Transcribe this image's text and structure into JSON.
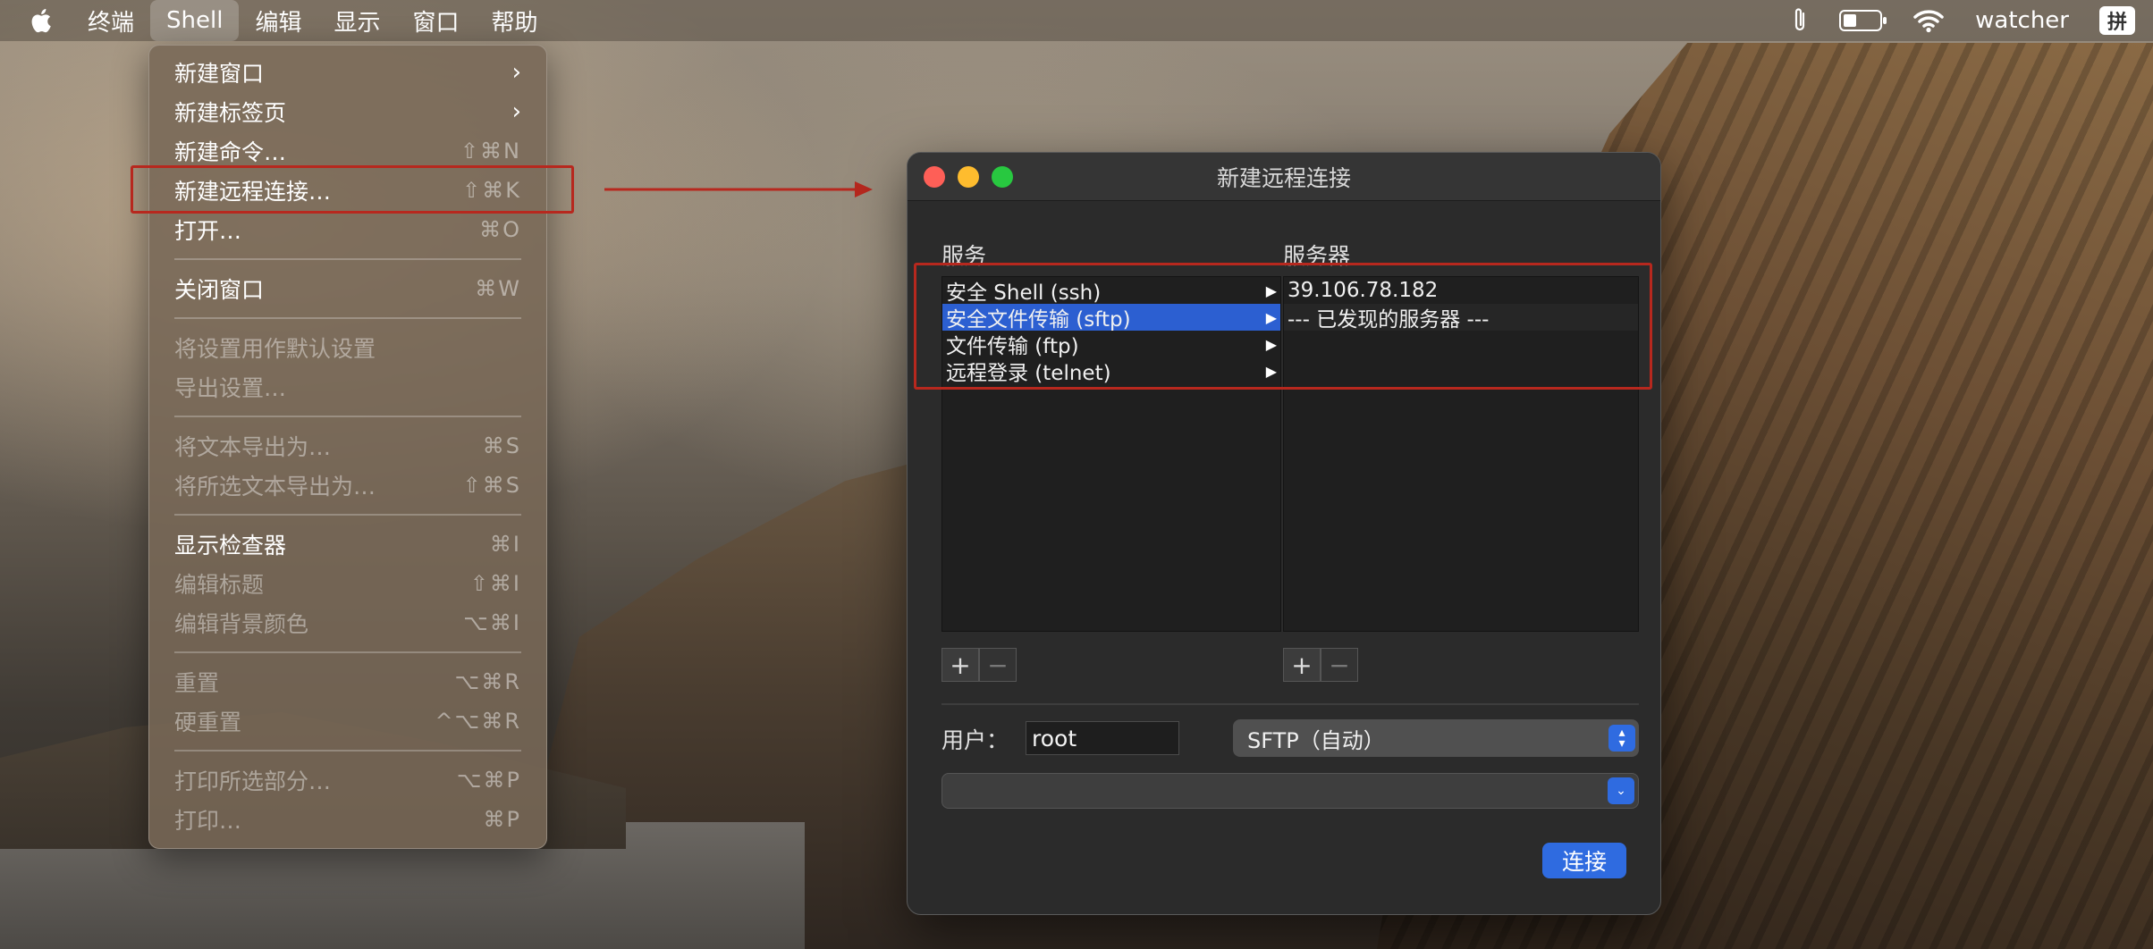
{
  "menubar": {
    "items": [
      "终端",
      "Shell",
      "编辑",
      "显示",
      "窗口",
      "帮助"
    ],
    "active_index": 1,
    "right": {
      "user": "watcher",
      "ime": "拼",
      "battery_level": 0.35
    }
  },
  "shell_menu": {
    "items": [
      {
        "label": "新建窗口",
        "shortcut": "",
        "submenu": true,
        "disabled": false
      },
      {
        "label": "新建标签页",
        "shortcut": "",
        "submenu": true,
        "disabled": false
      },
      {
        "label": "新建命令…",
        "shortcut": "⇧⌘N",
        "submenu": false,
        "disabled": false
      },
      {
        "label": "新建远程连接…",
        "shortcut": "⇧⌘K",
        "submenu": false,
        "disabled": false
      },
      {
        "label": "打开…",
        "shortcut": "⌘O",
        "submenu": false,
        "disabled": false
      },
      {
        "label": "关闭窗口",
        "shortcut": "⌘W",
        "submenu": false,
        "disabled": false
      },
      {
        "label": "将设置用作默认设置",
        "shortcut": "",
        "submenu": false,
        "disabled": true
      },
      {
        "label": "导出设置…",
        "shortcut": "",
        "submenu": false,
        "disabled": true
      },
      {
        "label": "将文本导出为…",
        "shortcut": "⌘S",
        "submenu": false,
        "disabled": true
      },
      {
        "label": "将所选文本导出为…",
        "shortcut": "⇧⌘S",
        "submenu": false,
        "disabled": true
      },
      {
        "label": "显示检查器",
        "shortcut": "⌘I",
        "submenu": false,
        "disabled": false
      },
      {
        "label": "编辑标题",
        "shortcut": "⇧⌘I",
        "submenu": false,
        "disabled": true
      },
      {
        "label": "编辑背景颜色",
        "shortcut": "⌥⌘I",
        "submenu": false,
        "disabled": true
      },
      {
        "label": "重置",
        "shortcut": "⌥⌘R",
        "submenu": false,
        "disabled": true
      },
      {
        "label": "硬重置",
        "shortcut": "^⌥⌘R",
        "submenu": false,
        "disabled": true
      },
      {
        "label": "打印所选部分…",
        "shortcut": "⌥⌘P",
        "submenu": false,
        "disabled": true
      },
      {
        "label": "打印…",
        "shortcut": "⌘P",
        "submenu": false,
        "disabled": true
      }
    ]
  },
  "dialog": {
    "title": "新建远程连接",
    "services_label": "服务",
    "servers_label": "服务器",
    "services": [
      {
        "label": "安全 Shell (ssh)",
        "selected": false
      },
      {
        "label": "安全文件传输 (sftp)",
        "selected": true
      },
      {
        "label": "文件传输 (ftp)",
        "selected": false
      },
      {
        "label": "远程登录 (telnet)",
        "selected": false
      }
    ],
    "servers": [
      "39.106.78.182",
      "--- 已发现的服务器 ---"
    ],
    "add_symbol": "+",
    "remove_symbol": "−",
    "user_label": "用户：",
    "user_value": "root",
    "protocol_value": "SFTP（自动）",
    "connect_label": "连接"
  },
  "colors": {
    "accent": "#2f6be0",
    "annotation": "#b7281e",
    "selection": "#2c5fd1"
  }
}
